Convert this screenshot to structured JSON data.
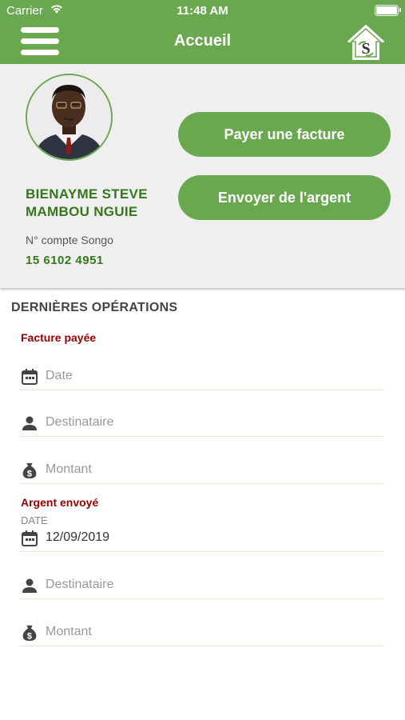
{
  "status_bar": {
    "carrier": "Carrier",
    "time": "11:48 AM"
  },
  "header": {
    "title": "Accueil",
    "menu_icon": "hamburger-menu-icon",
    "home_icon": "songo-home-logo-icon",
    "home_logo_letter": "S"
  },
  "profile": {
    "name_line1": "BIENAYME STEVE",
    "name_line2": "MAMBOU NGUIE",
    "account_label": "N° compte Songo",
    "account_number": "15 6102 4951"
  },
  "actions": {
    "pay_label": "Payer une facture",
    "send_label": "Envoyer de l'argent"
  },
  "operations": {
    "title": "DERNIÈRES OPÉRATIONS",
    "bill_paid": {
      "title": "Facture payée",
      "date_placeholder": "Date",
      "recipient_placeholder": "Destinataire",
      "amount_placeholder": "Montant"
    },
    "money_sent": {
      "title": "Argent envoyé",
      "date_label": "DATE",
      "date_value": "12/09/2019",
      "recipient_placeholder": "Destinataire",
      "amount_placeholder": "Montant"
    }
  },
  "colors": {
    "primary_green": "#6aa84f",
    "dark_green": "#38761d",
    "maroon": "#990000"
  }
}
